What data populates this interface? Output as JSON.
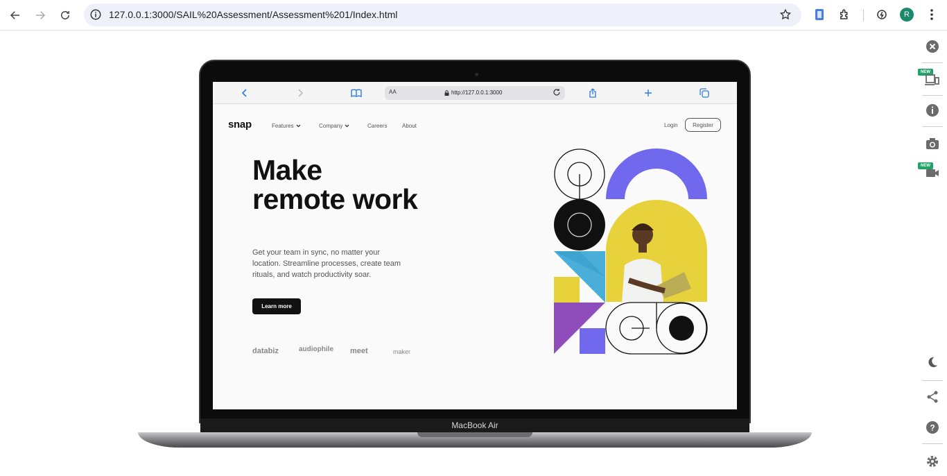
{
  "browser": {
    "url": "127.0.0.1:3000/SAIL%20Assessment/Assessment%201/Index.html",
    "profile_initial": "R"
  },
  "side_panel": {
    "new_badge_1": "NEW",
    "new_badge_2": "NEW"
  },
  "laptop": {
    "brand": "MacBook Air"
  },
  "safari": {
    "text_size": "AA",
    "url": "http://127.0.0.1:3000"
  },
  "site": {
    "logo": "snap",
    "nav": {
      "features": "Features",
      "company": "Company",
      "careers": "Careers",
      "about": "About",
      "login": "Login",
      "register": "Register"
    },
    "headline_line1": "Make",
    "headline_line2": "remote work",
    "subtext": "Get your team in sync, no matter your location. Streamline processes, create team rituals, and watch productivity soar.",
    "cta": "Learn more",
    "clients": [
      "databiz",
      "audiophile",
      "meet",
      "maker"
    ]
  },
  "colors": {
    "accent_purple": "#7069ed",
    "accent_yellow": "#e8d23c",
    "accent_blue": "#4aaed9",
    "accent_violet": "#8e4dbb",
    "dark": "#111111"
  }
}
